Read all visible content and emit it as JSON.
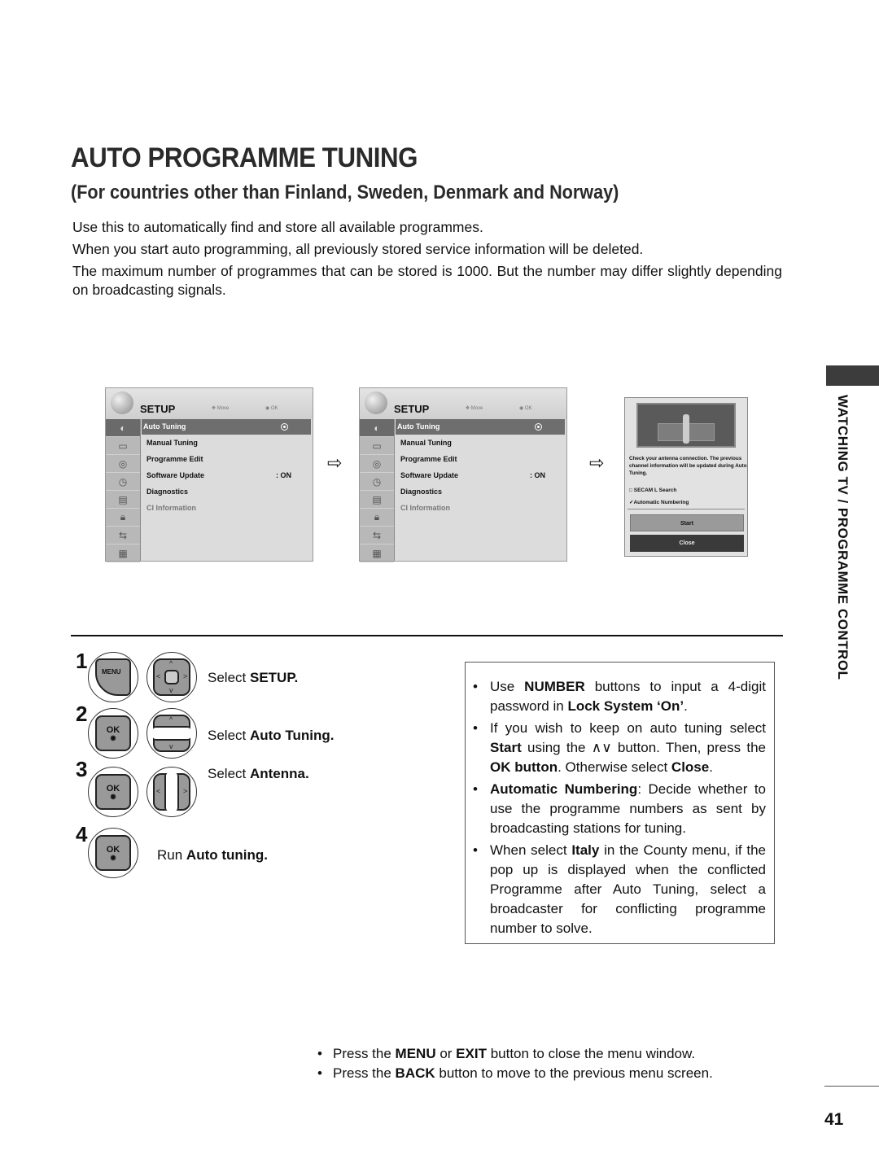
{
  "header": {
    "title": "AUTO PROGRAMME TUNING",
    "subtitle": "(For countries other than Finland, Sweden, Denmark and Norway)"
  },
  "intro": [
    "Use this to automatically find and store all available programmes.",
    "When you start auto programming, all previously stored service information will be deleted.",
    "The maximum number of programmes that can be stored is 1000. But the number may differ slightly depending on broadcasting signals."
  ],
  "osd_menu": {
    "title": "SETUP",
    "hint_move": "Move",
    "hint_ok": "OK",
    "items": [
      {
        "label": "Auto Tuning",
        "value": "",
        "selected": true
      },
      {
        "label": "Manual Tuning",
        "value": ""
      },
      {
        "label": "Programme Edit",
        "value": ""
      },
      {
        "label": "Software Update",
        "value": ": ON"
      },
      {
        "label": "Diagnostics",
        "value": ""
      },
      {
        "label": "CI Information",
        "value": "",
        "disabled": true
      }
    ],
    "side_icons": [
      "antenna-icon",
      "picture-icon",
      "audio-icon",
      "time-icon",
      "option-icon",
      "lock-icon",
      "input-icon",
      "usb-icon"
    ]
  },
  "dialog": {
    "message": "Check your antenna connection. The previous channel information will be updated during Auto Tuning.",
    "option_secam": "SECAM L Search",
    "option_secam_checked": false,
    "option_numbering": "Automatic Numbering",
    "option_numbering_checked": true,
    "start_label": "Start",
    "close_label": "Close"
  },
  "steps": [
    {
      "num": "1",
      "prefix": "Select ",
      "bold": "SETUP."
    },
    {
      "num": "2",
      "prefix": "Select ",
      "bold": "Auto Tuning."
    },
    {
      "num": "3",
      "prefix": "Select ",
      "bold": "Antenna."
    },
    {
      "num": "4",
      "prefix": "Run ",
      "bold": "Auto tuning."
    }
  ],
  "buttons": {
    "menu": "MENU",
    "ok": "OK"
  },
  "notes": [
    {
      "parts": [
        "Use ",
        "NUMBER",
        " buttons to input a 4-digit password in ",
        "Lock System ‘On’",
        "."
      ]
    },
    {
      "parts": [
        "If you wish to keep on auto tuning select ",
        "Start",
        " using the ∧∨ button. Then, press the ",
        "OK button",
        ". Otherwise select ",
        "Close",
        "."
      ]
    },
    {
      "parts": [
        "",
        "Automatic Numbering",
        ": Decide whether to use the programme numbers as sent by broadcasting stations for tuning."
      ]
    },
    {
      "parts": [
        "When select ",
        "Italy",
        " in the County menu, if the pop up is displayed when the conflicted Programme after Auto Tuning, select a broadcaster for conflicting programme number to solve."
      ]
    }
  ],
  "side_label": "WATCHING TV / PROGRAMME CONTROL",
  "footer_notes": [
    {
      "parts": [
        "Press the ",
        "MENU",
        " or ",
        "EXIT",
        " button to close the menu window."
      ]
    },
    {
      "parts": [
        "Press the ",
        "BACK",
        "  button to move to the previous menu screen."
      ]
    }
  ],
  "page_number": "41"
}
